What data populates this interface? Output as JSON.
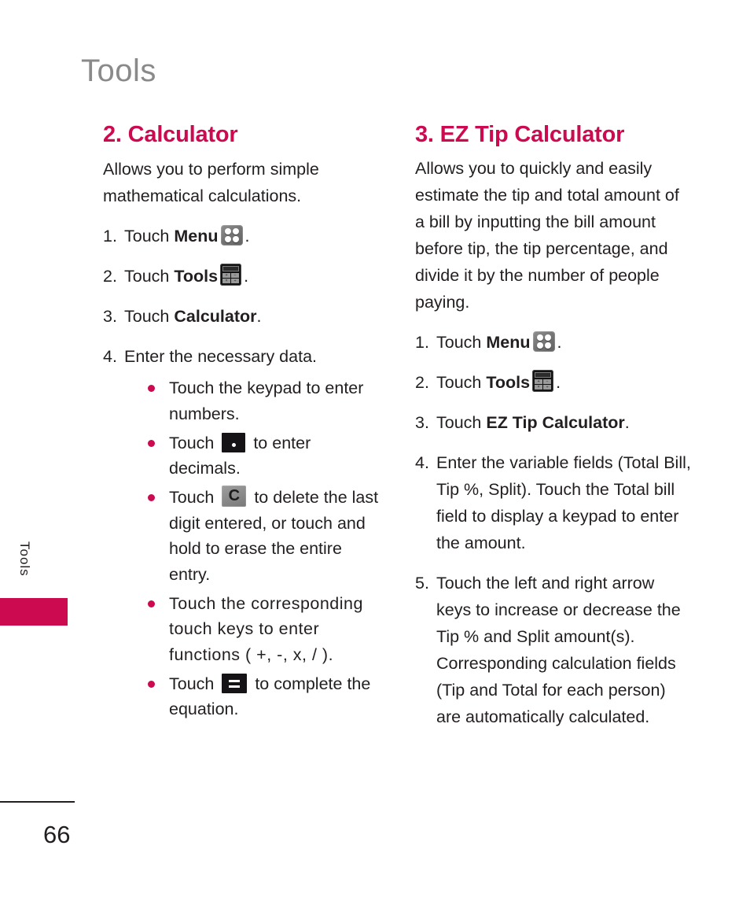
{
  "page": {
    "header_title": "Tools",
    "side_tab_label": "Tools",
    "page_number": "66",
    "accent_color": "#cb0a50",
    "header_color": "#8a8a8a",
    "body_color": "#231f20"
  },
  "left_column": {
    "title": "2. Calculator",
    "intro": "Allows you to perform simple mathematical calculations.",
    "steps": [
      {
        "number": "1.",
        "text_before": "Touch ",
        "bold": "Menu",
        "icon": "menu-icon",
        "text_after": "."
      },
      {
        "number": "2.",
        "text_before": "Touch ",
        "bold": "Tools",
        "icon": "tools-calculator-icon",
        "text_after": "."
      },
      {
        "number": "3.",
        "text_before": "Touch ",
        "bold": "Calculator",
        "icon": "",
        "text_after": "."
      },
      {
        "number": "4.",
        "text_before": "Enter the necessary data.",
        "bold": "",
        "icon": "",
        "text_after": ""
      }
    ],
    "bullets": [
      {
        "text_before": "Touch the keypad to enter numbers.",
        "icon": "",
        "text_after": ""
      },
      {
        "text_before": "Touch ",
        "icon": "decimal-point-key-icon",
        "text_after": " to enter decimals."
      },
      {
        "text_before": "Touch ",
        "icon": "clear-key-icon",
        "text_after": " to delete the last digit entered, or touch and hold to erase the entire entry."
      },
      {
        "text_before": "Touch the corresponding touch keys to enter functions ( +, -, x, / ).",
        "icon": "",
        "text_after": ""
      },
      {
        "text_before": "Touch ",
        "icon": "equals-key-icon",
        "text_after": " to complete the equation."
      }
    ]
  },
  "right_column": {
    "title": "3. EZ Tip Calculator",
    "intro": "Allows you to quickly and easily estimate the tip and total amount of a bill by inputting the bill amount before tip, the tip percentage, and divide it by the number of people paying.",
    "steps": [
      {
        "number": "1.",
        "text_before": "Touch ",
        "bold": "Menu",
        "icon": "menu-icon",
        "text_after": "."
      },
      {
        "number": "2.",
        "text_before": "Touch ",
        "bold": "Tools",
        "icon": "tools-calculator-icon",
        "text_after": "."
      },
      {
        "number": "3.",
        "text_before": "Touch ",
        "bold": "EZ Tip Calculator",
        "icon": "",
        "text_after": "."
      },
      {
        "number": "4.",
        "text_before": "Enter the variable fields (Total Bill, Tip %, Split). Touch the Total bill field to display a keypad to enter the amount.",
        "bold": "",
        "icon": "",
        "text_after": ""
      },
      {
        "number": "5.",
        "text_before": "Touch the left and right arrow keys to increase or decrease the Tip % and Split amount(s). Corresponding calculation fields (Tip and Total for each person) are automatically calculated.",
        "bold": "",
        "icon": "",
        "text_after": ""
      }
    ]
  },
  "icon_glyphs": {
    "tools_keys": [
      "+",
      "−",
      "×",
      "÷"
    ],
    "clear_letter": "C"
  }
}
